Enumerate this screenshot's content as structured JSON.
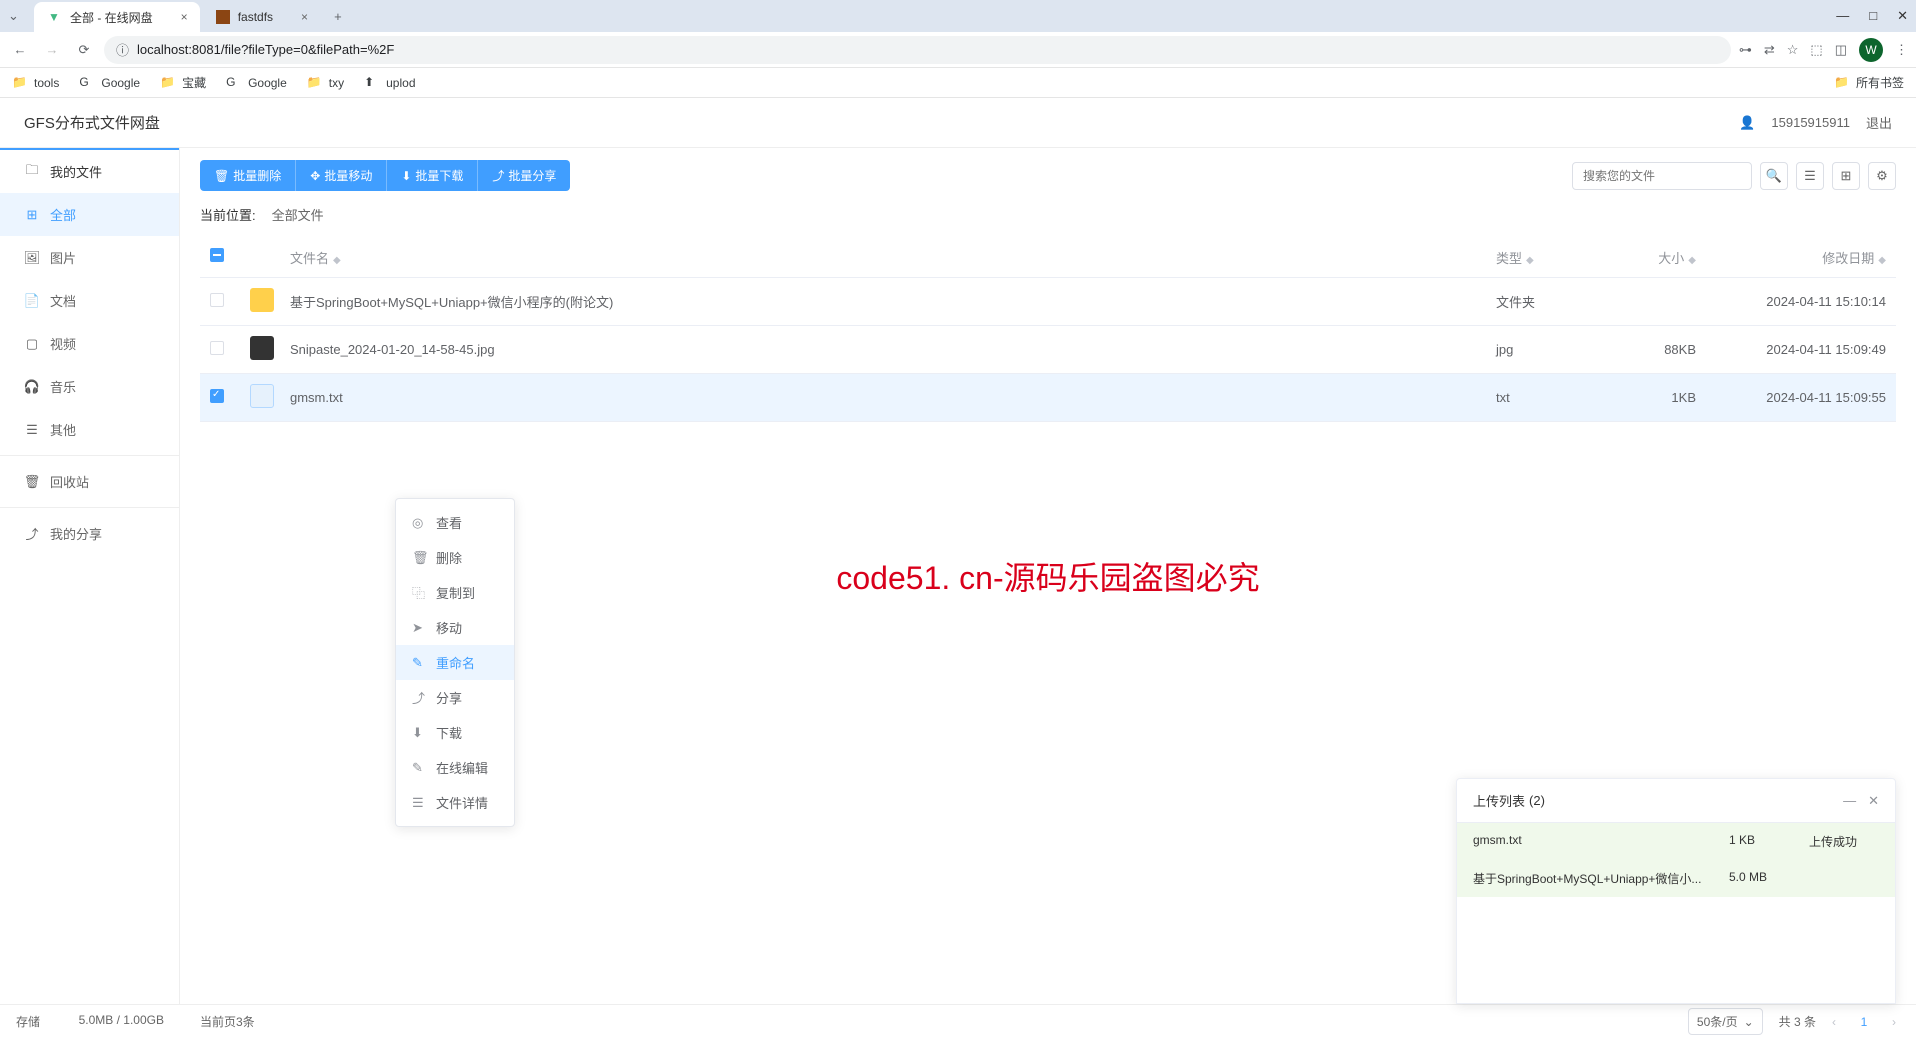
{
  "browser": {
    "tabs": [
      {
        "title": "全部 - 在线网盘",
        "active": true
      },
      {
        "title": "fastdfs",
        "active": false
      }
    ],
    "url": "localhost:8081/file?fileType=0&filePath=%2F",
    "bookmarks": [
      "tools",
      "Google",
      "宝藏",
      "Google",
      "txy",
      "uplod"
    ],
    "all_bookmarks": "所有书签"
  },
  "header": {
    "app_title": "GFS分布式文件网盘",
    "user_phone": "15915915911",
    "logout": "退出"
  },
  "sidebar": {
    "my_files": "我的文件",
    "items": [
      {
        "label": "全部",
        "icon": "grid"
      },
      {
        "label": "图片",
        "icon": "image"
      },
      {
        "label": "文档",
        "icon": "doc"
      },
      {
        "label": "视频",
        "icon": "video"
      },
      {
        "label": "音乐",
        "icon": "music"
      },
      {
        "label": "其他",
        "icon": "other"
      }
    ],
    "recycle": "回收站",
    "my_share": "我的分享"
  },
  "toolbar": {
    "batch_delete": "批量删除",
    "batch_move": "批量移动",
    "batch_download": "批量下载",
    "batch_share": "批量分享",
    "search_placeholder": "搜索您的文件"
  },
  "breadcrumb": {
    "label": "当前位置:",
    "path": "全部文件"
  },
  "table": {
    "headers": {
      "name": "文件名",
      "type": "类型",
      "size": "大小",
      "date": "修改日期"
    },
    "rows": [
      {
        "name": "基于SpringBoot+MySQL+Uniapp+微信小程序的(附论文)",
        "type": "文件夹",
        "size": "",
        "date": "2024-04-11 15:10:14",
        "icon": "folder",
        "checked": false
      },
      {
        "name": "Snipaste_2024-01-20_14-58-45.jpg",
        "type": "jpg",
        "size": "88KB",
        "date": "2024-04-11 15:09:49",
        "icon": "img",
        "checked": false
      },
      {
        "name": "gmsm.txt",
        "type": "txt",
        "size": "1KB",
        "date": "2024-04-11 15:09:55",
        "icon": "txt",
        "checked": true
      }
    ]
  },
  "context_menu": {
    "items": [
      {
        "label": "查看",
        "icon": "◎"
      },
      {
        "label": "删除",
        "icon": "🗑"
      },
      {
        "label": "复制到",
        "icon": "⿻"
      },
      {
        "label": "移动",
        "icon": "➤"
      },
      {
        "label": "重命名",
        "icon": "✎",
        "hover": true
      },
      {
        "label": "分享",
        "icon": "⤴"
      },
      {
        "label": "下载",
        "icon": "⬇"
      },
      {
        "label": "在线编辑",
        "icon": "✎"
      },
      {
        "label": "文件详情",
        "icon": "☰"
      }
    ]
  },
  "watermark": "code51. cn-源码乐园盗图必究",
  "upload_panel": {
    "title": "上传列表",
    "count": "(2)",
    "rows": [
      {
        "name": "gmsm.txt",
        "size": "1 KB",
        "status": "上传成功"
      },
      {
        "name": "基于SpringBoot+MySQL+Uniapp+微信小...",
        "size": "5.0 MB",
        "status": ""
      }
    ]
  },
  "footer": {
    "storage_label": "存储",
    "storage_value": "5.0MB / 1.00GB",
    "page_count": "当前页3条",
    "per_page": "50条/页",
    "total": "共 3 条",
    "current_page": "1"
  }
}
